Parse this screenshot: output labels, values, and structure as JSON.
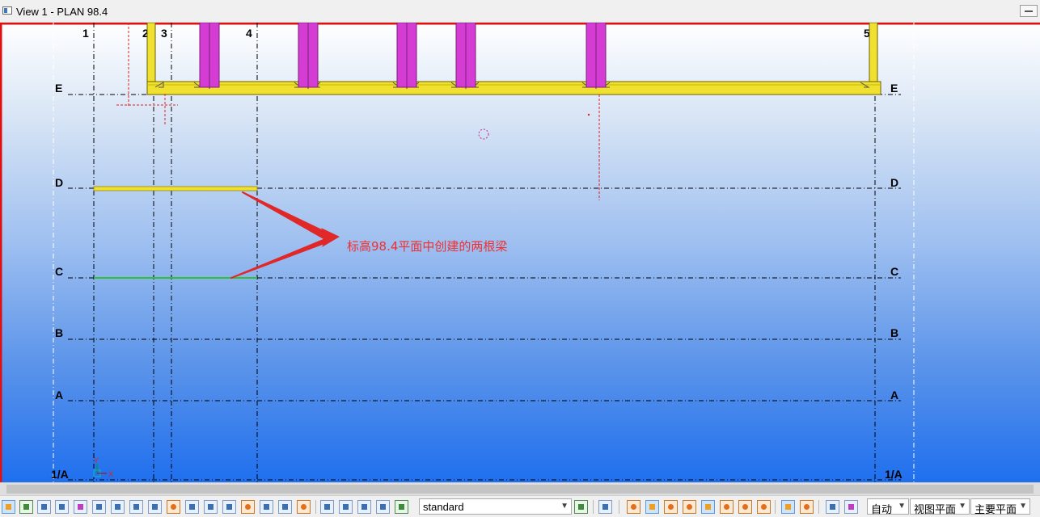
{
  "window": {
    "title": "View 1 - PLAN 98.4"
  },
  "grid": {
    "columns": [
      "1",
      "2",
      "3",
      "4",
      "5"
    ],
    "rows": [
      "E",
      "D",
      "C",
      "B",
      "A",
      "1/A"
    ]
  },
  "axis": {
    "y_label": "Y",
    "x_label": "X"
  },
  "annotation": {
    "text": "标高98.4平面中创建的两根梁"
  },
  "toolbar": {
    "filter_combo": "standard",
    "auto_combo": "自动",
    "view_plane_combo": "视图平面",
    "main_plane_combo": "主要平面"
  },
  "colors": {
    "beam_yellow": "#f0e030",
    "column_magenta": "#d43cd4",
    "grid_line": "#000000",
    "view_border": "#e01010",
    "annotation_red": "#f03030"
  }
}
